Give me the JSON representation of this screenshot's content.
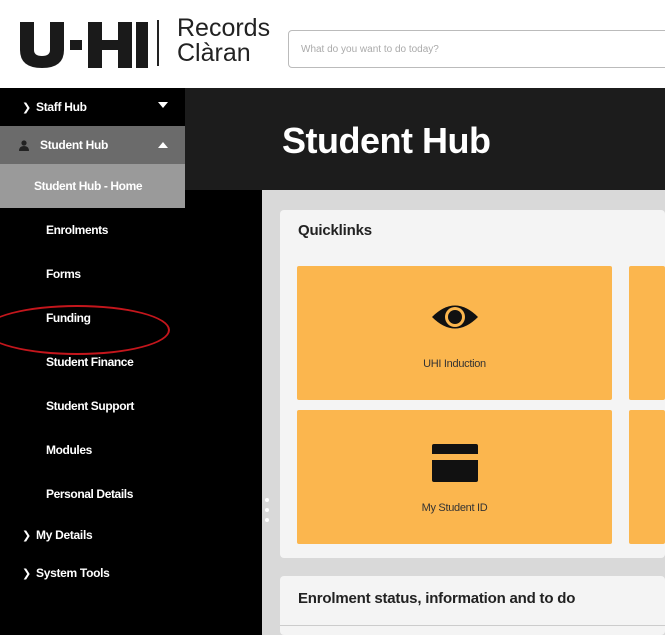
{
  "header": {
    "brand": "UHI",
    "product_line1": "Records",
    "product_line2": "Clàran",
    "search_placeholder": "What do you want to do today?"
  },
  "sidebar": {
    "staff_hub": "Staff Hub",
    "student_hub": "Student Hub",
    "student_hub_home": "Student Hub - Home",
    "sub_items": [
      "Enrolments",
      "Forms",
      "Funding",
      "Student Finance",
      "Student Support",
      "Modules",
      "Personal Details"
    ],
    "my_details": "My Details",
    "system_tools": "System Tools"
  },
  "main": {
    "page_title": "Student Hub",
    "quicklinks_title": "Quicklinks",
    "tiles": [
      {
        "label": "UHI Induction",
        "icon": "eye-icon"
      },
      {
        "label": "My Student ID",
        "icon": "id-card-icon"
      }
    ],
    "enrolment_title": "Enrolment status, information and to do"
  },
  "colors": {
    "tile": "#fbb64e",
    "sidebar": "#000000",
    "highlight_ring": "#c4161c"
  }
}
